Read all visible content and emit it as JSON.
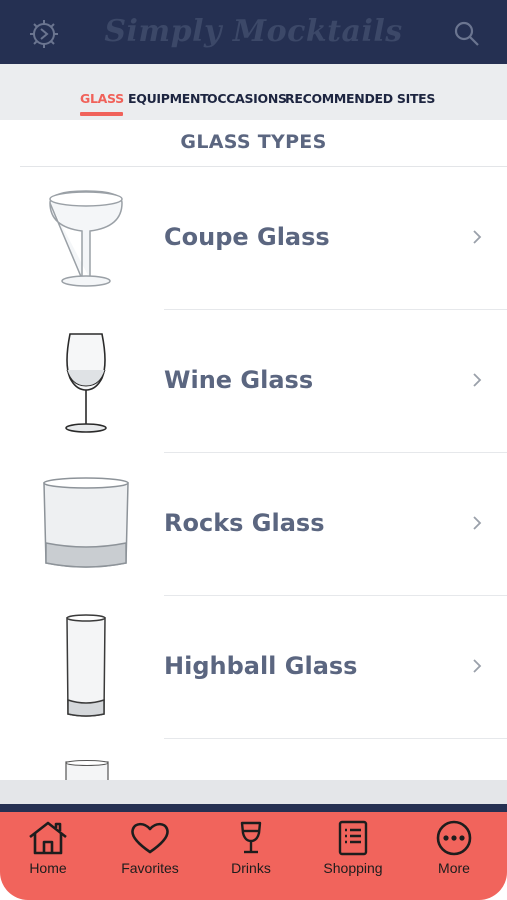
{
  "header": {
    "title": "Simply Mocktails",
    "left_icon": "gear-icon",
    "right_icon": "search-icon"
  },
  "tabs": [
    {
      "label": "GLASS",
      "active": true
    },
    {
      "label": "EQUIPMENT",
      "active": false
    },
    {
      "label": "OCCASIONS",
      "active": false
    },
    {
      "label": "RECOMMENDED SITES",
      "active": false
    }
  ],
  "section": {
    "title": "GLASS TYPES"
  },
  "glasses": [
    {
      "label": "Coupe Glass",
      "icon": "coupe-glass-image"
    },
    {
      "label": "Wine Glass",
      "icon": "wine-glass-image"
    },
    {
      "label": "Rocks Glass",
      "icon": "rocks-glass-image"
    },
    {
      "label": "Highball Glass",
      "icon": "highball-glass-image"
    }
  ],
  "bottom_nav": [
    {
      "label": "Home",
      "icon": "home-icon"
    },
    {
      "label": "Favorites",
      "icon": "heart-icon"
    },
    {
      "label": "Drinks",
      "icon": "drink-glass-icon"
    },
    {
      "label": "Shopping",
      "icon": "shopping-list-icon"
    },
    {
      "label": "More",
      "icon": "more-dots-icon"
    }
  ],
  "colors": {
    "header_bg": "#253052",
    "accent": "#f0625a",
    "tabs_bg": "#ebedef",
    "text_gray": "#5b6680",
    "bottom_nav_bg": "#f1645c"
  }
}
